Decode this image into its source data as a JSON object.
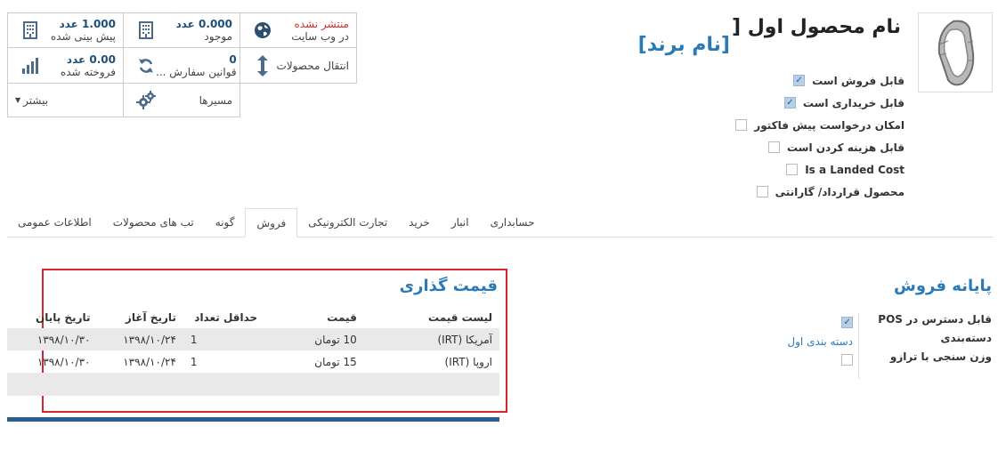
{
  "smart_buttons": {
    "website": {
      "status": "منتشر نشده",
      "label": "در وب سایت"
    },
    "on_hand": {
      "value": "0.000 عدد",
      "label": "موجود"
    },
    "forecast": {
      "value": "1.000 عدد",
      "label": "پیش بینی شده"
    },
    "moves": {
      "label": "انتقال محصولات"
    },
    "reorder": {
      "value": "0",
      "label": "قوانین سفارش ..."
    },
    "sold": {
      "value": "0.00 عدد",
      "label": "فروخته شده"
    },
    "routes": {
      "label": "مسیرها"
    },
    "more": {
      "label": "بیشتر"
    }
  },
  "product": {
    "bracket_open": "[",
    "name": "نام محصول اول",
    "brand": "[نام برند]"
  },
  "flags": [
    {
      "label": "قابل فروش است",
      "checked": true
    },
    {
      "label": "قابل خریداری است",
      "checked": true
    },
    {
      "label": "امکان درخواست پیش فاکتور",
      "checked": false
    },
    {
      "label": "قابل هزینه کردن است",
      "checked": false
    },
    {
      "label": "Is a Landed Cost",
      "checked": false
    },
    {
      "label": "محصول قرارداد/ گارانتی",
      "checked": false
    }
  ],
  "tabs": [
    {
      "label": "اطلاعات عمومی",
      "active": false
    },
    {
      "label": "تب های محصولات",
      "active": false
    },
    {
      "label": "گونه",
      "active": false
    },
    {
      "label": "فروش",
      "active": true
    },
    {
      "label": "تجارت الکترونیکی",
      "active": false
    },
    {
      "label": "خرید",
      "active": false
    },
    {
      "label": "انبار",
      "active": false
    },
    {
      "label": "حسابداری",
      "active": false
    }
  ],
  "pos": {
    "title": "پایانه فروش",
    "fields": [
      {
        "label": "قابل دسترس در POS",
        "value": "",
        "checked": true
      },
      {
        "label": "دسته‌بندی",
        "value": "دسته بندی اول"
      },
      {
        "label": "وزن سنجی با ترازو",
        "value": "",
        "checked": false
      }
    ]
  },
  "pricing": {
    "title": "قیمت گذاری",
    "columns": [
      "لیست قیمت",
      "قیمت",
      "حداقل تعداد",
      "تاریخ آغاز",
      "تاریخ پایان"
    ],
    "rows": [
      {
        "pricelist": "آمریکا (IRT)",
        "price": "10 تومان",
        "min_qty": "1",
        "start": "۱۳۹۸/۱۰/۲۴",
        "end": "۱۳۹۸/۱۰/۳۰"
      },
      {
        "pricelist": "اروپا (IRT)",
        "price": "15 تومان",
        "min_qty": "1",
        "start": "۱۳۹۸/۱۰/۲۴",
        "end": "۱۳۹۸/۱۰/۳۰"
      }
    ]
  },
  "colors": {
    "accent": "#2a7ab8",
    "highlight_frame": "#d7242f",
    "bar": "#2c5d8f"
  }
}
